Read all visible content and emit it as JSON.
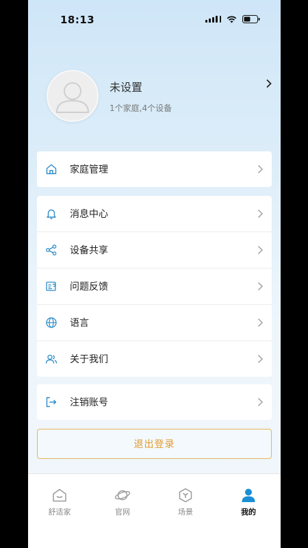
{
  "status_bar": {
    "time": "18:13"
  },
  "profile": {
    "name": "未设置",
    "subtitle": "1个家庭,4个设备"
  },
  "home_card": {
    "items": [
      {
        "label": "家庭管理",
        "icon": "home-icon"
      }
    ]
  },
  "main_card": {
    "items": [
      {
        "label": "消息中心",
        "icon": "bell-icon"
      },
      {
        "label": "设备共享",
        "icon": "share-icon"
      },
      {
        "label": "问题反馈",
        "icon": "feedback-icon"
      },
      {
        "label": "语言",
        "icon": "globe-icon"
      },
      {
        "label": "关于我们",
        "icon": "users-icon"
      }
    ]
  },
  "account_card": {
    "items": [
      {
        "label": "注销账号",
        "icon": "logout-arrow-icon"
      }
    ]
  },
  "logout_button": {
    "label": "退出登录"
  },
  "tab_bar": {
    "tabs": [
      {
        "label": "舒适家",
        "icon": "home-smile-icon",
        "active": false
      },
      {
        "label": "官网",
        "icon": "planet-icon",
        "active": false
      },
      {
        "label": "场景",
        "icon": "scene-icon",
        "active": false
      },
      {
        "label": "我的",
        "icon": "person-icon",
        "active": true
      }
    ]
  },
  "colors": {
    "accent": "#1a8fd6",
    "logout": "#e39b2c",
    "icon": "#2d8cc9"
  }
}
